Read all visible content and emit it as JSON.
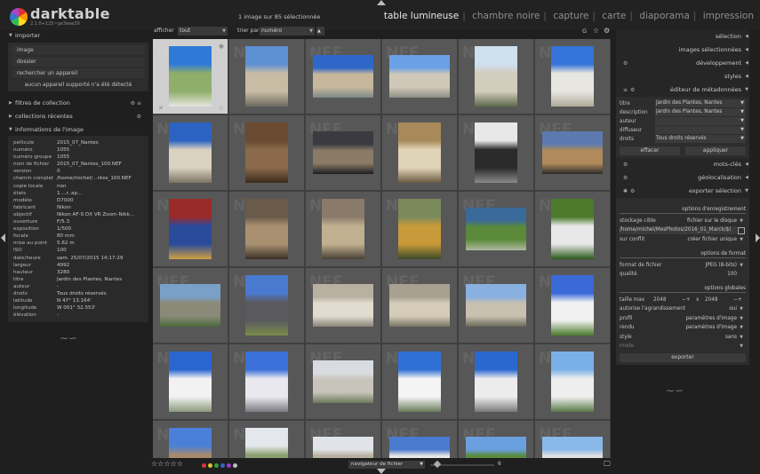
{
  "app": {
    "name": "darktable",
    "version": "2.1.0+125~ge3eee39",
    "image_count_text": "1 image sur 85 sélectionnée",
    "views": [
      {
        "label": "table lumineuse",
        "active": true
      },
      {
        "label": "chambre noire",
        "active": false
      },
      {
        "label": "capture",
        "active": false
      },
      {
        "label": "carte",
        "active": false
      },
      {
        "label": "diaporama",
        "active": false
      },
      {
        "label": "impression",
        "active": false
      }
    ]
  },
  "left": {
    "importer": {
      "title": "importer",
      "buttons": [
        "image",
        "dossier",
        "rechercher un appareil"
      ],
      "note": "aucun appareil supporté n'a été détecté"
    },
    "filters_title": "filtres de collection",
    "recent_title": "collections récentes",
    "info_title": "informations de l'image",
    "info": [
      {
        "k": "pellicule",
        "v": "2015_07_Nantes"
      },
      {
        "k": "numéro",
        "v": "1055"
      },
      {
        "k": "numéro groupe",
        "v": "1055"
      },
      {
        "k": "nom de fichier",
        "v": "2015_07_Nantes_100.NEF"
      },
      {
        "k": "version",
        "v": "0"
      },
      {
        "k": "chemin complet",
        "v": "/home/michel/...ntes_100.NEF"
      },
      {
        "k": "copie locale",
        "v": "non"
      },
      {
        "k": "états",
        "v": "1....r..ap..."
      },
      {
        "k": "modèle",
        "v": "D7000"
      },
      {
        "k": "fabricant",
        "v": "Nikon"
      },
      {
        "k": "objectif",
        "v": "Nikon AF-S DX VR Zoom-Nikk..."
      },
      {
        "k": "ouverture",
        "v": "F/5.3"
      },
      {
        "k": "exposition",
        "v": "1/500"
      },
      {
        "k": "focale",
        "v": "80 mm"
      },
      {
        "k": "mise au point",
        "v": "5.62 m"
      },
      {
        "k": "ISO",
        "v": "100"
      },
      {
        "k": "date/heure",
        "v": "sam. 25/07/2015 14:17:29"
      },
      {
        "k": "largeur",
        "v": "4992"
      },
      {
        "k": "hauteur",
        "v": "3280"
      },
      {
        "k": "titre",
        "v": "Jardin des Plantes, Nantes"
      },
      {
        "k": "auteur",
        "v": "-"
      },
      {
        "k": "droits",
        "v": "Tous droits réservés"
      },
      {
        "k": "latitude",
        "v": "N 47° 13.164'"
      },
      {
        "k": "longitude",
        "v": "W 001° 32.553'"
      },
      {
        "k": "élévation",
        "v": "-"
      }
    ]
  },
  "filter": {
    "show_label": "afficher",
    "show_value": "tout",
    "sort_label": "trier par",
    "sort_value": "numéro",
    "grouping_label": "G"
  },
  "grid": {
    "watermark": "NEF",
    "selected_index": 0
  },
  "bottom": {
    "stars": "☆☆☆☆☆",
    "color_labels": [
      "#d03a3a",
      "#d8c52e",
      "#3aa13a",
      "#3a62c8",
      "#9b3ac8",
      "#bdbdbd"
    ],
    "navigator": "navigateur de fichier",
    "zoom": "6"
  },
  "right": {
    "headers": {
      "selection": "sélection",
      "selected_images": "images sélectionnées",
      "development": "développement",
      "styles": "styles",
      "metadata": "éditeur de métadonnées",
      "keywords": "mots-clés",
      "geotagging": "géolocalisation",
      "export": "exporter sélection"
    },
    "metadata": [
      {
        "k": "titre",
        "v": "Jardin des Plantes, Nantes"
      },
      {
        "k": "description",
        "v": "Jardin des Plantes, Nantes"
      },
      {
        "k": "auteur",
        "v": ""
      },
      {
        "k": "diffuseur",
        "v": ""
      },
      {
        "k": "droits",
        "v": "Tous droits réservés"
      }
    ],
    "metadata_buttons": {
      "clear": "effacer",
      "apply": "appliquer"
    },
    "export": {
      "storage_section": "options d'enregistrement",
      "target_storage_label": "stockage cible",
      "target_storage_value": "fichier sur le disque",
      "path": "/home/michel/MesPhotos/2016_01_Marck/$(",
      "on_conflict_label": "sur conflit",
      "on_conflict_value": "créer fichier unique",
      "format_section": "options de format",
      "file_format_label": "format de fichier",
      "file_format_value": "JPEG (8-bits)",
      "quality_label": "qualité",
      "quality_value": "100",
      "global_section": "options globales",
      "max_size_label": "taille max",
      "max_w": "2048",
      "max_h": "2048",
      "times": "x",
      "upscale_label": "autorise l'agrandissement",
      "upscale_value": "oui",
      "profile_label": "profil",
      "profile_value": "paramètres d'image",
      "intent_label": "rendu",
      "intent_value": "paramètres d'image",
      "style_label": "style",
      "style_value": "sans",
      "mode_label": "mode",
      "export_button": "exporter"
    }
  }
}
